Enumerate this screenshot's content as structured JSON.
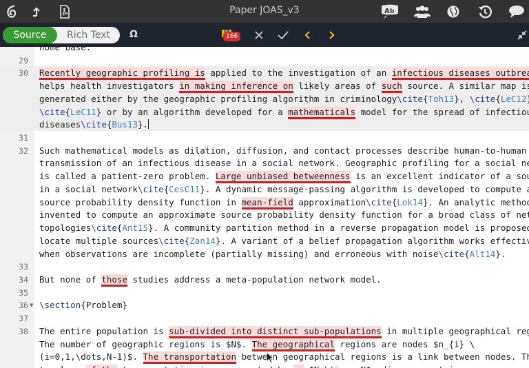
{
  "app_bar": {
    "document_title": "Paper JOAS_v3",
    "left_icons": [
      "overleaf-logo-icon",
      "upload-icon",
      "pdf-icon"
    ],
    "right_icons": [
      "spellcheck-icon",
      "collaborators-icon",
      "globe-icon",
      "history-icon",
      "chat-icon"
    ]
  },
  "toolbar": {
    "source_label": "Source",
    "rich_text_label": "Rich Text",
    "symbol_label": "Ω",
    "review_count": "166",
    "accent_colors": {
      "source_active": "#3a9b35",
      "badge": "#d0312d",
      "arrows": "#e6b800"
    }
  },
  "editor": {
    "lines": [
      {
        "number": "",
        "segments": [
          {
            "t": "home base."
          }
        ]
      },
      {
        "number": "29",
        "segments": [
          {
            "t": ""
          }
        ]
      },
      {
        "number": "30",
        "segments": [
          {
            "t": "Recently geographic profiling is",
            "c": "hl"
          },
          {
            "t": " applied to the investigation of an "
          },
          {
            "t": "infectious diseases outbreak.",
            "c": "hl"
          },
          {
            "t": " It"
          }
        ]
      },
      {
        "number": "",
        "segments": [
          {
            "t": "helps health investigators "
          },
          {
            "t": "in making inference on",
            "c": "hl"
          },
          {
            "t": " likely areas of "
          },
          {
            "t": "such",
            "c": "hl"
          },
          {
            "t": " source. A similar map is"
          }
        ]
      },
      {
        "number": "",
        "segments": [
          {
            "t": "generated either by the geographic profiling algorithm in criminology"
          },
          {
            "t": "\\cite",
            "c": "kw"
          },
          {
            "t": "{"
          },
          {
            "t": "Toh13",
            "c": "arg"
          },
          {
            "t": "}, "
          },
          {
            "t": "\\cite",
            "c": "kw"
          },
          {
            "t": "{"
          },
          {
            "t": "LeC12",
            "c": "arg"
          },
          {
            "t": "},"
          }
        ]
      },
      {
        "number": "",
        "segments": [
          {
            "t": "\\cite",
            "c": "kw"
          },
          {
            "t": "{"
          },
          {
            "t": "LeC11",
            "c": "arg"
          },
          {
            "t": "} or by an algorithm developed for a "
          },
          {
            "t": "mathematicals",
            "c": "hl"
          },
          {
            "t": " model for the spread of infectious"
          }
        ]
      },
      {
        "number": "",
        "segments": [
          {
            "t": "diseases"
          },
          {
            "t": "\\cite",
            "c": "kw"
          },
          {
            "t": "{"
          },
          {
            "t": "Bus13",
            "c": "arg"
          },
          {
            "t": "}."
          }
        ],
        "caret": true
      },
      {
        "number": "31",
        "segments": [
          {
            "t": ""
          }
        ]
      },
      {
        "number": "32",
        "segments": [
          {
            "t": "Such mathematical models as dilation, diffusion, and contact processes describe human-to-human"
          }
        ]
      },
      {
        "number": "",
        "segments": [
          {
            "t": "transmission of an infectious disease in a social network. Geographic profiling for a social network"
          }
        ]
      },
      {
        "number": "",
        "segments": [
          {
            "t": "is called a patient-zero problem. "
          },
          {
            "t": "Large unbiased betweenness",
            "c": "hl"
          },
          {
            "t": " is an excellent indicator of a source"
          }
        ]
      },
      {
        "number": "",
        "segments": [
          {
            "t": "in a social network"
          },
          {
            "t": "\\cite",
            "c": "kw"
          },
          {
            "t": "{"
          },
          {
            "t": "CesC11",
            "c": "arg"
          },
          {
            "t": "}. A dynamic message-passing algorithm is developed to compute a"
          }
        ]
      },
      {
        "number": "",
        "segments": [
          {
            "t": "source probability density function in "
          },
          {
            "t": "mean-field",
            "c": "hl"
          },
          {
            "t": " approximation"
          },
          {
            "t": "\\cite",
            "c": "kw"
          },
          {
            "t": "{"
          },
          {
            "t": "Lok14",
            "c": "arg"
          },
          {
            "t": "}. An analytic method is"
          }
        ]
      },
      {
        "number": "",
        "segments": [
          {
            "t": "invented to compute an approximate source probability density function for a broad class of network"
          }
        ]
      },
      {
        "number": "",
        "segments": [
          {
            "t": "topologies"
          },
          {
            "t": "\\cite",
            "c": "kw"
          },
          {
            "t": "{"
          },
          {
            "t": "Ant15",
            "c": "arg"
          },
          {
            "t": "}. A community partition method in a reverse propagation model is proposed to"
          }
        ]
      },
      {
        "number": "",
        "segments": [
          {
            "t": "locate multiple sources"
          },
          {
            "t": "\\cite",
            "c": "kw"
          },
          {
            "t": "{"
          },
          {
            "t": "Zan14",
            "c": "arg"
          },
          {
            "t": "}. A variant of a belief propagation algorithm works effectively"
          }
        ]
      },
      {
        "number": "",
        "segments": [
          {
            "t": "when observations are incomplete (partially missing) and erroneous with noise"
          },
          {
            "t": "\\cite",
            "c": "kw"
          },
          {
            "t": "{"
          },
          {
            "t": "Alt14",
            "c": "arg"
          },
          {
            "t": "}."
          }
        ]
      },
      {
        "number": "33",
        "segments": [
          {
            "t": ""
          }
        ]
      },
      {
        "number": "34",
        "segments": [
          {
            "t": "But none of "
          },
          {
            "t": "those",
            "c": "hl"
          },
          {
            "t": " studies address a meta-population network model."
          }
        ]
      },
      {
        "number": "35",
        "segments": [
          {
            "t": ""
          }
        ]
      },
      {
        "number": "36",
        "fold": true,
        "segments": [
          {
            "t": "\\section",
            "c": "kw"
          },
          {
            "t": "{Problem}"
          }
        ]
      },
      {
        "number": "37",
        "segments": [
          {
            "t": ""
          }
        ]
      },
      {
        "number": "38",
        "segments": [
          {
            "t": "The entire population is "
          },
          {
            "t": "sub-divided into distinct sub-populations",
            "c": "hl"
          },
          {
            "t": " in multiple geographical regions."
          }
        ]
      },
      {
        "number": "",
        "segments": [
          {
            "t": "The number of geographic regions is $N$. "
          },
          {
            "t": "The geographical",
            "c": "hl"
          },
          {
            "t": " regions are nodes $n_{i} \\"
          }
        ]
      },
      {
        "number": "",
        "segments": [
          {
            "t": "(i=0,1,\\dots,N-1)$. "
          },
          {
            "t": "The transportation",
            "c": "hl"
          },
          {
            "t": " between geographical regions is a link between nodes. The"
          }
        ]
      },
      {
        "number": "",
        "segments": [
          {
            "t": "topology "
          },
          {
            "t": "of the",
            "c": "hl"
          },
          {
            "t": " transportation is represented by "
          },
          {
            "t": "an",
            "c": "hl"
          },
          {
            "t": " $N \\times N$ adjacency matrix"
          }
        ]
      }
    ]
  }
}
